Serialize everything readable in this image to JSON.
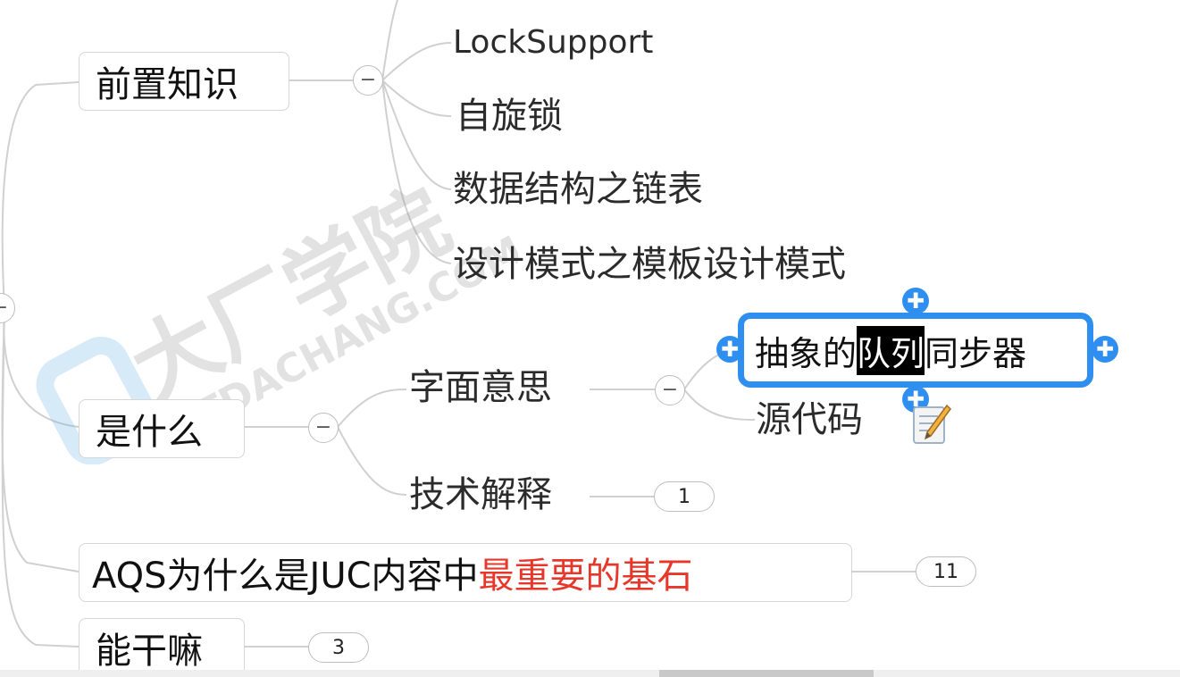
{
  "nodes": {
    "prereq": "前置知识",
    "locksupport": "LockSupport",
    "spinlock": "自旋锁",
    "linkedlist": "数据结构之链表",
    "template": "设计模式之模板设计模式",
    "what": "是什么",
    "literal": "字面意思",
    "tech": "技术解释",
    "aqs_black": "AQS为什么是JUC内容中",
    "aqs_red": "最重要的基石",
    "usage": "能干嘛",
    "source": "源代码",
    "selected_pre": "抽象的",
    "selected_hl": "队列",
    "selected_post": "同步器"
  },
  "badges": {
    "tech_count": "1",
    "aqs_count": "11",
    "usage_count": "3"
  },
  "symbols": {
    "collapse": "−",
    "plus": "✚"
  },
  "watermark": {
    "brand": "大厂学院",
    "domain": "ITDACHANG.COM"
  },
  "colors": {
    "accent": "#2f8ff0",
    "red_text": "#e6372a",
    "connector": "#d0d0d0"
  },
  "icons": {
    "note": "note-pencil-icon"
  }
}
